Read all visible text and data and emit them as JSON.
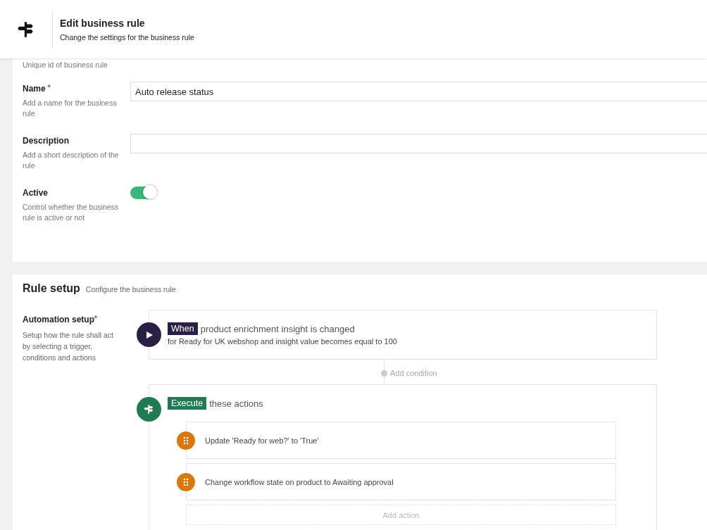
{
  "header": {
    "title": "Edit business rule",
    "subtitle": "Change the settings for the business rule"
  },
  "general": {
    "cut_hint": "Unique id of business rule",
    "fields": [
      {
        "kind": "text",
        "label": "Name",
        "required_mark": "*",
        "hint": "Add a name for the business rule",
        "value": "Auto release status"
      },
      {
        "kind": "text",
        "label": "Description",
        "hint": "Add a short description of the rule"
      },
      {
        "kind": "toggle",
        "label": "Active",
        "hint": "Control whether the business rule is active or not",
        "on": true
      }
    ]
  },
  "rule_setup": {
    "title": "Rule setup",
    "subtitle": "Configure the business rule",
    "label": "Automation setup",
    "required_mark": "*",
    "hint": "Setup how the rule shall act by selecting a trigger, conditions and actions",
    "trigger": {
      "tag": "When",
      "text": "product enrichment insight is changed",
      "detail": "for Ready for UK webshop and insight value becomes equal to 100"
    },
    "add_condition": "Add condition",
    "execute": {
      "tag": "Execute",
      "text": "these actions",
      "actions": [
        "Update 'Ready for web?' to 'True'",
        "Change workflow state on product to Awaiting approval"
      ],
      "add_action": "Add action"
    }
  }
}
